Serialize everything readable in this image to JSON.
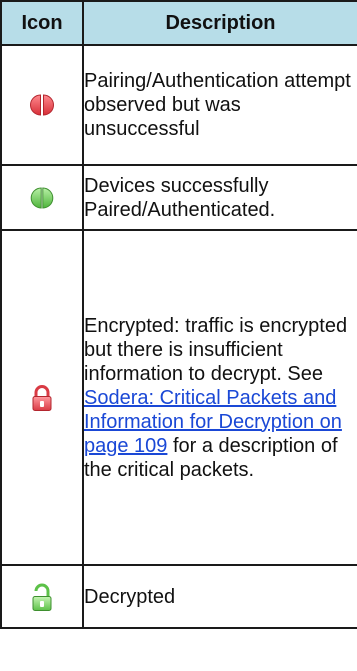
{
  "table": {
    "headers": {
      "icon": "Icon",
      "description": "Description"
    },
    "rows": [
      {
        "icon": "red-split-circle-icon",
        "text": "Pairing/Authentication attempt observed but was unsuccessful"
      },
      {
        "icon": "green-split-circle-icon",
        "text": "Devices successfully Paired/Authenticated."
      },
      {
        "icon": "red-locked-padlock-icon",
        "text_before": "Encrypted: traffic is encrypted but there is insufficient information to decrypt. See ",
        "link": "Sodera: Critical Packets and Information for Decryption on page 109",
        "text_after": " for a description of the critical packets."
      },
      {
        "icon": "green-unlocked-padlock-icon",
        "text": "Decrypted"
      }
    ]
  },
  "colors": {
    "header_background": "#b7dde8",
    "link": "#1a48d6",
    "fail_red": "#e8474f",
    "success_green": "#7fd36b"
  }
}
